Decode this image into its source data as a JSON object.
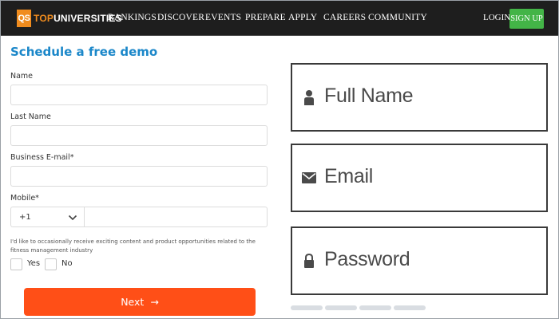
{
  "nav": {
    "logo_badge": "QS",
    "logo_top": "TOP",
    "logo_rest": "UNIVERSITIES",
    "items": [
      "RANKINGS",
      "DISCOVER",
      "EVENTS",
      "PREPARE",
      "APPLY",
      "CAREERS",
      "COMMUNITY"
    ],
    "login": "LOGIN",
    "signup": "SIGN UP"
  },
  "form": {
    "title": "Schedule a free demo",
    "name_label": "Name",
    "name_value": "",
    "last_name_label": "Last Name",
    "last_name_value": "",
    "email_label": "Business E-mail*",
    "email_value": "",
    "mobile_label": "Mobile*",
    "country_code": "+1",
    "mobile_value": "",
    "consent_text": "I'd like to occasionally receive exciting content and product opportunities related to the fitness management industry",
    "yes_label": "Yes",
    "no_label": "No",
    "next_label": "Next",
    "next_arrow": "→"
  },
  "illustration": {
    "fields": [
      {
        "label": "Full Name",
        "icon": "user-icon"
      },
      {
        "label": "Email",
        "icon": "envelope-icon"
      },
      {
        "label": "Password",
        "icon": "lock-icon"
      }
    ],
    "progress_segments": 4
  },
  "colors": {
    "nav_bg": "#1e1e1e",
    "logo_orange": "#f08c1e",
    "signup_green": "#43b447",
    "title_blue": "#1b87c9",
    "next_orange": "#ff4f17"
  }
}
